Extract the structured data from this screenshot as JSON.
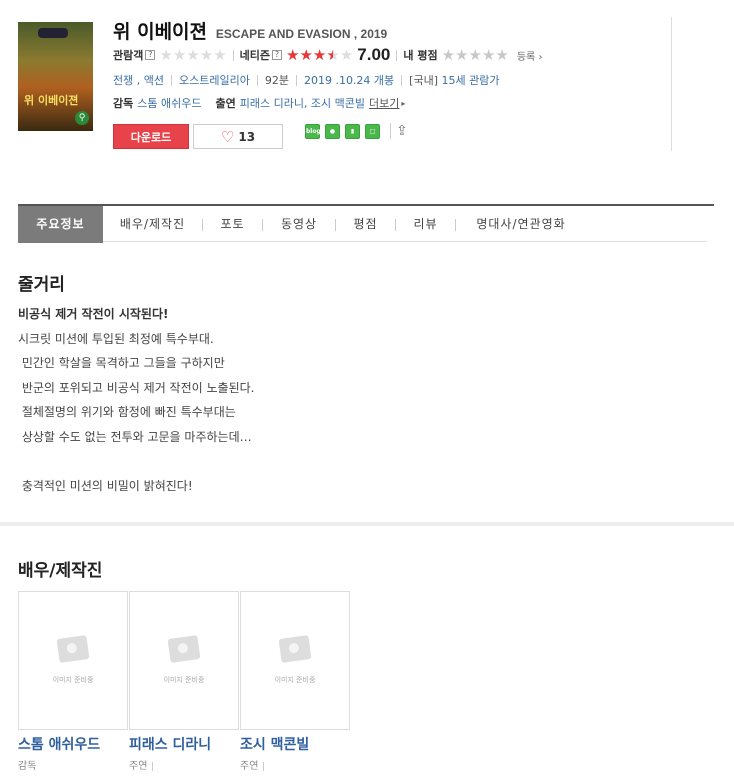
{
  "movie": {
    "title_ko": "위 이베이젼",
    "title_en": "ESCAPE AND EVASION , 2019",
    "poster": {
      "title_text": "위 이베이젼"
    }
  },
  "ratings": {
    "audience_label": "관람객",
    "audience_stars": 0,
    "netizen_label": "네티즌",
    "netizen_stars": 3.5,
    "netizen_score": "7.00",
    "my_label": "내 평점",
    "my_stars": 0,
    "register_label": "등록",
    "help_mark": "?",
    "colors": {
      "active_star": "#e8343b",
      "empty_star": "#dddddd"
    }
  },
  "info": {
    "genre": "전쟁 , 액션",
    "country": "오스트레일리아",
    "runtime": "92분",
    "release": "2019 .10.24 개봉",
    "rating_region": "[국내]",
    "age_rating": "15세 관람가"
  },
  "credits": {
    "director_label": "감독",
    "director": "스톰 애쉬우드",
    "cast_label": "출연",
    "cast": "피래스 디라니, 조시 맥콘빌",
    "more": "더보기"
  },
  "actions": {
    "download_label": "다운로드",
    "like_count": "13",
    "share_icons": [
      "blog-icon",
      "band-icon",
      "bookmark-icon",
      "line-icon"
    ]
  },
  "tabs": [
    "주요정보",
    "배우/제작진",
    "포토",
    "동영상",
    "평점",
    "리뷰",
    "명대사/연관영화"
  ],
  "synopsis": {
    "heading": "줄거리",
    "lead": "비공식 제거 작전이 시작된다!",
    "lines": [
      "시크릿 미션에 투입된 최정예 특수부대.",
      " 민간인 학살을 목격하고 그들을 구하지만",
      " 반군의 포위되고 비공식 제거 작전이 노출된다.",
      " 절체절명의 위기와 함정에 빠진 특수부대는",
      " 상상할 수도 없는 전투와 고문을 마주하는데…",
      "",
      " 충격적인 미션의 비밀이 밝혀진다!"
    ]
  },
  "cast_section": {
    "heading": "배우/제작진",
    "placeholder_text": "이미지 준비중",
    "people": [
      {
        "name": "스톰 애쉬우드",
        "role": "감독"
      },
      {
        "name": "피래스 디라니",
        "role": "주연"
      },
      {
        "name": "조시 맥콘빌",
        "role": "주연"
      }
    ]
  }
}
